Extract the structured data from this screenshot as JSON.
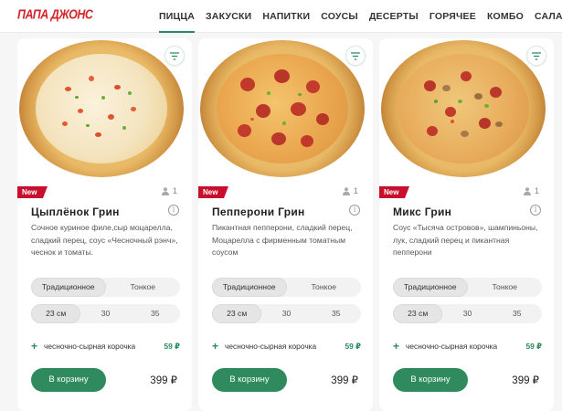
{
  "header": {
    "logo": "ПАПА ДЖОНС",
    "nav": [
      {
        "label": "ПИЦЦА",
        "active": true
      },
      {
        "label": "ЗАКУСКИ",
        "active": false
      },
      {
        "label": "НАПИТКИ",
        "active": false
      },
      {
        "label": "СОУСЫ",
        "active": false
      },
      {
        "label": "ДЕСЕРТЫ",
        "active": false
      },
      {
        "label": "ГОРЯЧЕЕ",
        "active": false
      },
      {
        "label": "КОМБО",
        "active": false
      },
      {
        "label": "САЛАТЫ",
        "active": false
      }
    ],
    "accent_color": "#2b8a5c",
    "brand_color": "#d2262b"
  },
  "cards": [
    {
      "badge": "New",
      "persons": "1",
      "title": "Цыплёнок Грин",
      "description": "Сочное куриное филе,сыр моцарелла, сладкий перец, соус «Чесночный рэнч», чеснок и томаты.",
      "crust_options": [
        "Традиционное",
        "Тонкое"
      ],
      "crust_selected": "Традиционное",
      "size_options": [
        "23 см",
        "30",
        "35"
      ],
      "size_selected": "23 см",
      "addon_label": "чесночно-сырная корочка",
      "addon_price": "59 ₽",
      "cart_label": "В корзину",
      "price": "399 ₽",
      "image_icon": "pizza-chicken-green-image"
    },
    {
      "badge": "New",
      "persons": "1",
      "title": "Пепперони Грин",
      "description": "Пикантная пепперони, сладкий перец, Моцарелла с фирменным томатным соусом",
      "crust_options": [
        "Традиционное",
        "Тонкое"
      ],
      "crust_selected": "Традиционное",
      "size_options": [
        "23 см",
        "30",
        "35"
      ],
      "size_selected": "23 см",
      "addon_label": "чесночно-сырная корочка",
      "addon_price": "59 ₽",
      "cart_label": "В корзину",
      "price": "399 ₽",
      "image_icon": "pizza-pepperoni-green-image"
    },
    {
      "badge": "New",
      "persons": "1",
      "title": "Микс Грин",
      "description": "Соус «Тысяча островов», шампиньоны, лук, сладкий перец и пикантная пепперони",
      "crust_options": [
        "Традиционное",
        "Тонкое"
      ],
      "crust_selected": "Традиционное",
      "size_options": [
        "23 см",
        "30",
        "35"
      ],
      "size_selected": "23 см",
      "addon_label": "чесночно-сырная корочка",
      "addon_price": "59 ₽",
      "cart_label": "В корзину",
      "price": "399 ₽",
      "image_icon": "pizza-mix-green-image"
    }
  ]
}
